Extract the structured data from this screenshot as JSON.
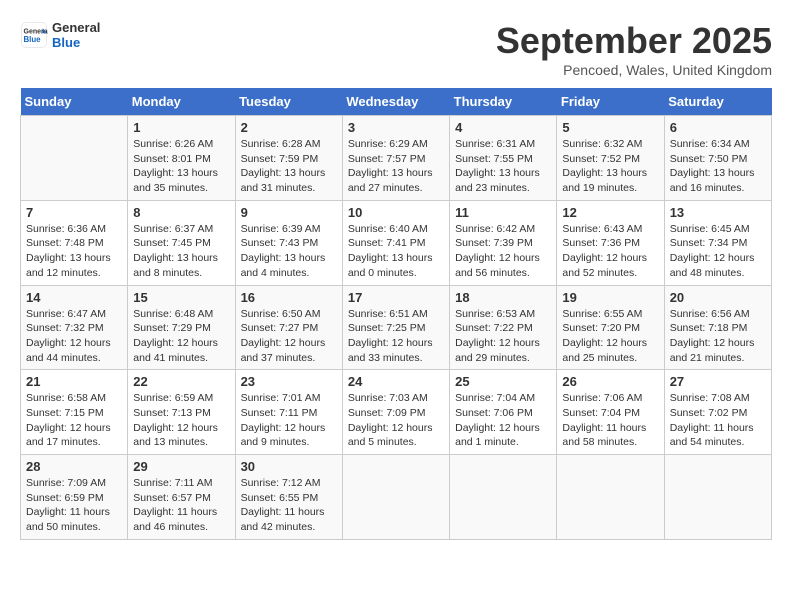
{
  "header": {
    "logo_line1": "General",
    "logo_line2": "Blue",
    "month": "September 2025",
    "location": "Pencoed, Wales, United Kingdom"
  },
  "weekdays": [
    "Sunday",
    "Monday",
    "Tuesday",
    "Wednesday",
    "Thursday",
    "Friday",
    "Saturday"
  ],
  "weeks": [
    [
      {
        "day": "",
        "info": ""
      },
      {
        "day": "1",
        "info": "Sunrise: 6:26 AM\nSunset: 8:01 PM\nDaylight: 13 hours\nand 35 minutes."
      },
      {
        "day": "2",
        "info": "Sunrise: 6:28 AM\nSunset: 7:59 PM\nDaylight: 13 hours\nand 31 minutes."
      },
      {
        "day": "3",
        "info": "Sunrise: 6:29 AM\nSunset: 7:57 PM\nDaylight: 13 hours\nand 27 minutes."
      },
      {
        "day": "4",
        "info": "Sunrise: 6:31 AM\nSunset: 7:55 PM\nDaylight: 13 hours\nand 23 minutes."
      },
      {
        "day": "5",
        "info": "Sunrise: 6:32 AM\nSunset: 7:52 PM\nDaylight: 13 hours\nand 19 minutes."
      },
      {
        "day": "6",
        "info": "Sunrise: 6:34 AM\nSunset: 7:50 PM\nDaylight: 13 hours\nand 16 minutes."
      }
    ],
    [
      {
        "day": "7",
        "info": "Sunrise: 6:36 AM\nSunset: 7:48 PM\nDaylight: 13 hours\nand 12 minutes."
      },
      {
        "day": "8",
        "info": "Sunrise: 6:37 AM\nSunset: 7:45 PM\nDaylight: 13 hours\nand 8 minutes."
      },
      {
        "day": "9",
        "info": "Sunrise: 6:39 AM\nSunset: 7:43 PM\nDaylight: 13 hours\nand 4 minutes."
      },
      {
        "day": "10",
        "info": "Sunrise: 6:40 AM\nSunset: 7:41 PM\nDaylight: 13 hours\nand 0 minutes."
      },
      {
        "day": "11",
        "info": "Sunrise: 6:42 AM\nSunset: 7:39 PM\nDaylight: 12 hours\nand 56 minutes."
      },
      {
        "day": "12",
        "info": "Sunrise: 6:43 AM\nSunset: 7:36 PM\nDaylight: 12 hours\nand 52 minutes."
      },
      {
        "day": "13",
        "info": "Sunrise: 6:45 AM\nSunset: 7:34 PM\nDaylight: 12 hours\nand 48 minutes."
      }
    ],
    [
      {
        "day": "14",
        "info": "Sunrise: 6:47 AM\nSunset: 7:32 PM\nDaylight: 12 hours\nand 44 minutes."
      },
      {
        "day": "15",
        "info": "Sunrise: 6:48 AM\nSunset: 7:29 PM\nDaylight: 12 hours\nand 41 minutes."
      },
      {
        "day": "16",
        "info": "Sunrise: 6:50 AM\nSunset: 7:27 PM\nDaylight: 12 hours\nand 37 minutes."
      },
      {
        "day": "17",
        "info": "Sunrise: 6:51 AM\nSunset: 7:25 PM\nDaylight: 12 hours\nand 33 minutes."
      },
      {
        "day": "18",
        "info": "Sunrise: 6:53 AM\nSunset: 7:22 PM\nDaylight: 12 hours\nand 29 minutes."
      },
      {
        "day": "19",
        "info": "Sunrise: 6:55 AM\nSunset: 7:20 PM\nDaylight: 12 hours\nand 25 minutes."
      },
      {
        "day": "20",
        "info": "Sunrise: 6:56 AM\nSunset: 7:18 PM\nDaylight: 12 hours\nand 21 minutes."
      }
    ],
    [
      {
        "day": "21",
        "info": "Sunrise: 6:58 AM\nSunset: 7:15 PM\nDaylight: 12 hours\nand 17 minutes."
      },
      {
        "day": "22",
        "info": "Sunrise: 6:59 AM\nSunset: 7:13 PM\nDaylight: 12 hours\nand 13 minutes."
      },
      {
        "day": "23",
        "info": "Sunrise: 7:01 AM\nSunset: 7:11 PM\nDaylight: 12 hours\nand 9 minutes."
      },
      {
        "day": "24",
        "info": "Sunrise: 7:03 AM\nSunset: 7:09 PM\nDaylight: 12 hours\nand 5 minutes."
      },
      {
        "day": "25",
        "info": "Sunrise: 7:04 AM\nSunset: 7:06 PM\nDaylight: 12 hours\nand 1 minute."
      },
      {
        "day": "26",
        "info": "Sunrise: 7:06 AM\nSunset: 7:04 PM\nDaylight: 11 hours\nand 58 minutes."
      },
      {
        "day": "27",
        "info": "Sunrise: 7:08 AM\nSunset: 7:02 PM\nDaylight: 11 hours\nand 54 minutes."
      }
    ],
    [
      {
        "day": "28",
        "info": "Sunrise: 7:09 AM\nSunset: 6:59 PM\nDaylight: 11 hours\nand 50 minutes."
      },
      {
        "day": "29",
        "info": "Sunrise: 7:11 AM\nSunset: 6:57 PM\nDaylight: 11 hours\nand 46 minutes."
      },
      {
        "day": "30",
        "info": "Sunrise: 7:12 AM\nSunset: 6:55 PM\nDaylight: 11 hours\nand 42 minutes."
      },
      {
        "day": "",
        "info": ""
      },
      {
        "day": "",
        "info": ""
      },
      {
        "day": "",
        "info": ""
      },
      {
        "day": "",
        "info": ""
      }
    ]
  ]
}
